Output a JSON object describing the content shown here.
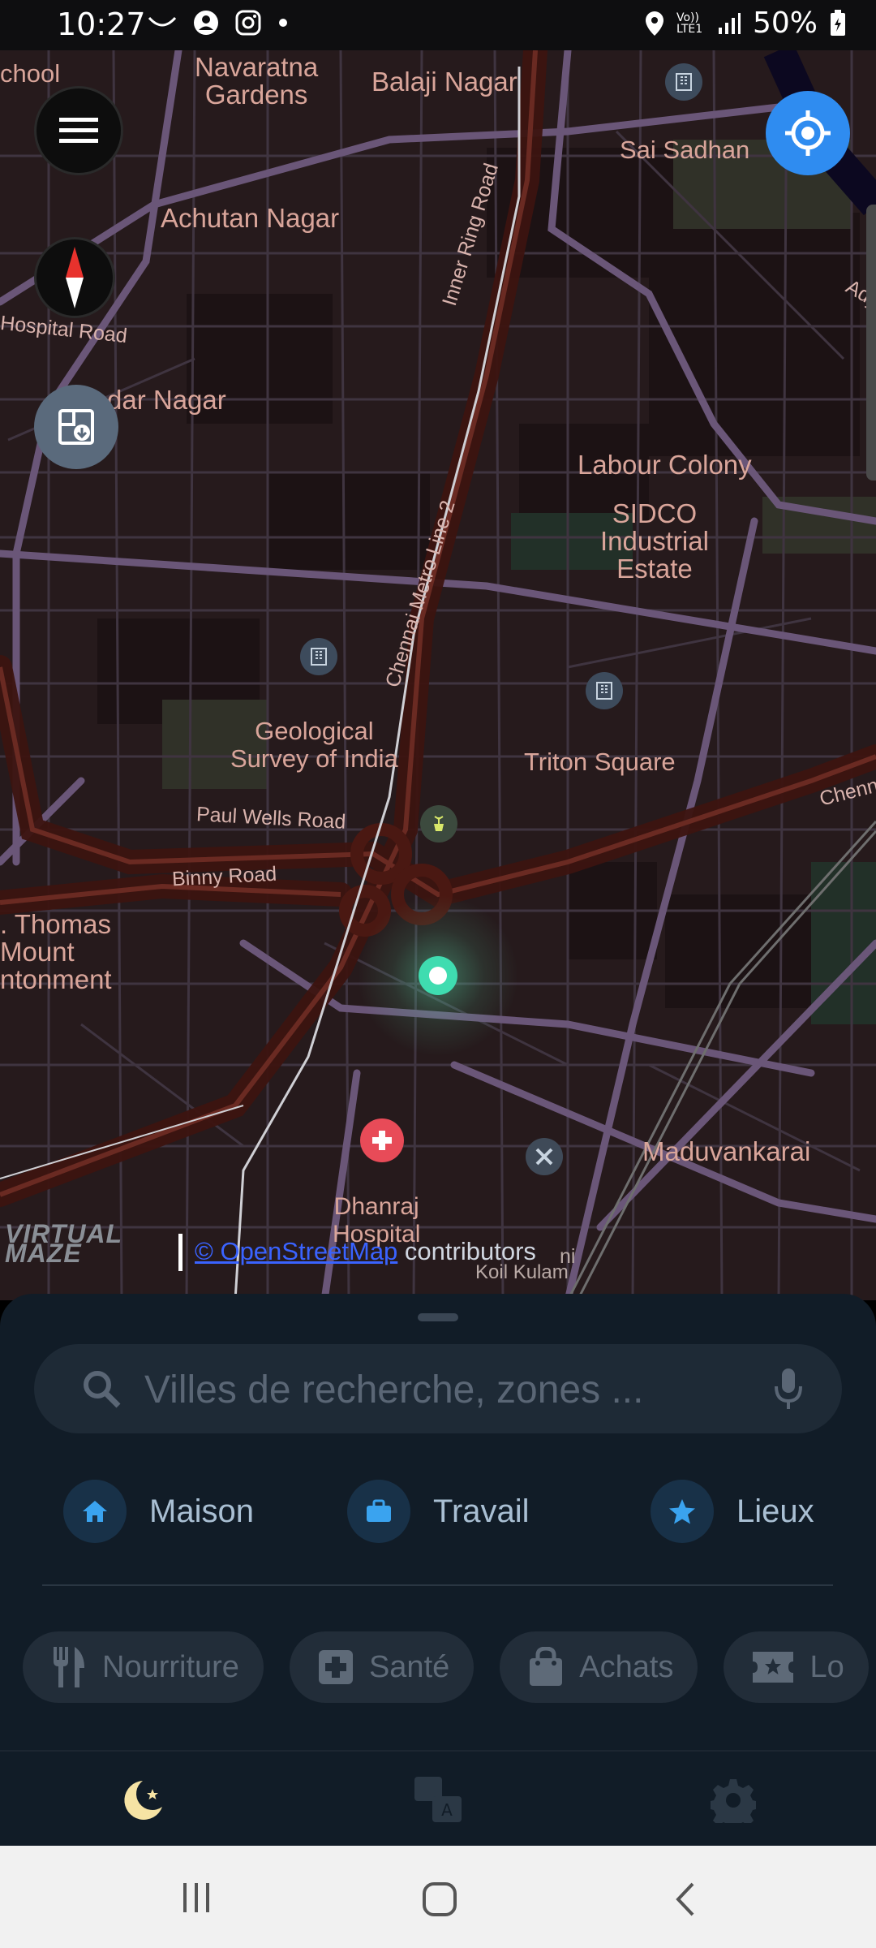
{
  "status_bar": {
    "time": "10:27",
    "battery": "50%",
    "network_label": "Vo)) LTE1"
  },
  "map": {
    "places": [
      "Navaratna\nGardens",
      "Balaji Nagar",
      "Sai Sadhan",
      "Achutan Nagar",
      "dar Nagar",
      "Labour Colony",
      "SIDCO\nIndustrial\nEstate",
      "Geological\nSurvey of India",
      "Triton Square",
      ". Thomas\nMount\nntonment",
      "Maduvankarai",
      "Dhanraj\nHospital",
      "chool"
    ],
    "roads": [
      "Inner Ring Road",
      "Chennai Metro Line 2",
      "Paul Wells Road",
      "Binny Road",
      "Hospital Road",
      "Chenn",
      "Ady"
    ],
    "small_labels": [
      "ni",
      "Koil Kulam"
    ],
    "attribution": {
      "logo": "VIRTUAL\nMAZE",
      "link": "© OpenStreetMap",
      "suffix": " contributors"
    }
  },
  "search": {
    "placeholder": "Villes de recherche, zones ..."
  },
  "quick_actions": [
    {
      "label": "Maison",
      "icon": "home-icon"
    },
    {
      "label": "Travail",
      "icon": "briefcase-icon"
    },
    {
      "label": "Lieux",
      "icon": "star-icon"
    }
  ],
  "categories": [
    {
      "label": "Nourriture",
      "icon": "fork-knife-icon"
    },
    {
      "label": "Santé",
      "icon": "health-cross-icon"
    },
    {
      "label": "Achats",
      "icon": "shopping-bag-icon"
    },
    {
      "label": "Lo",
      "icon": "ticket-icon"
    }
  ],
  "colors": {
    "accent": "#2f8cf0",
    "sheet": "#111c27",
    "map_bg": "#261a1c",
    "moon": "#f6e3a4"
  }
}
